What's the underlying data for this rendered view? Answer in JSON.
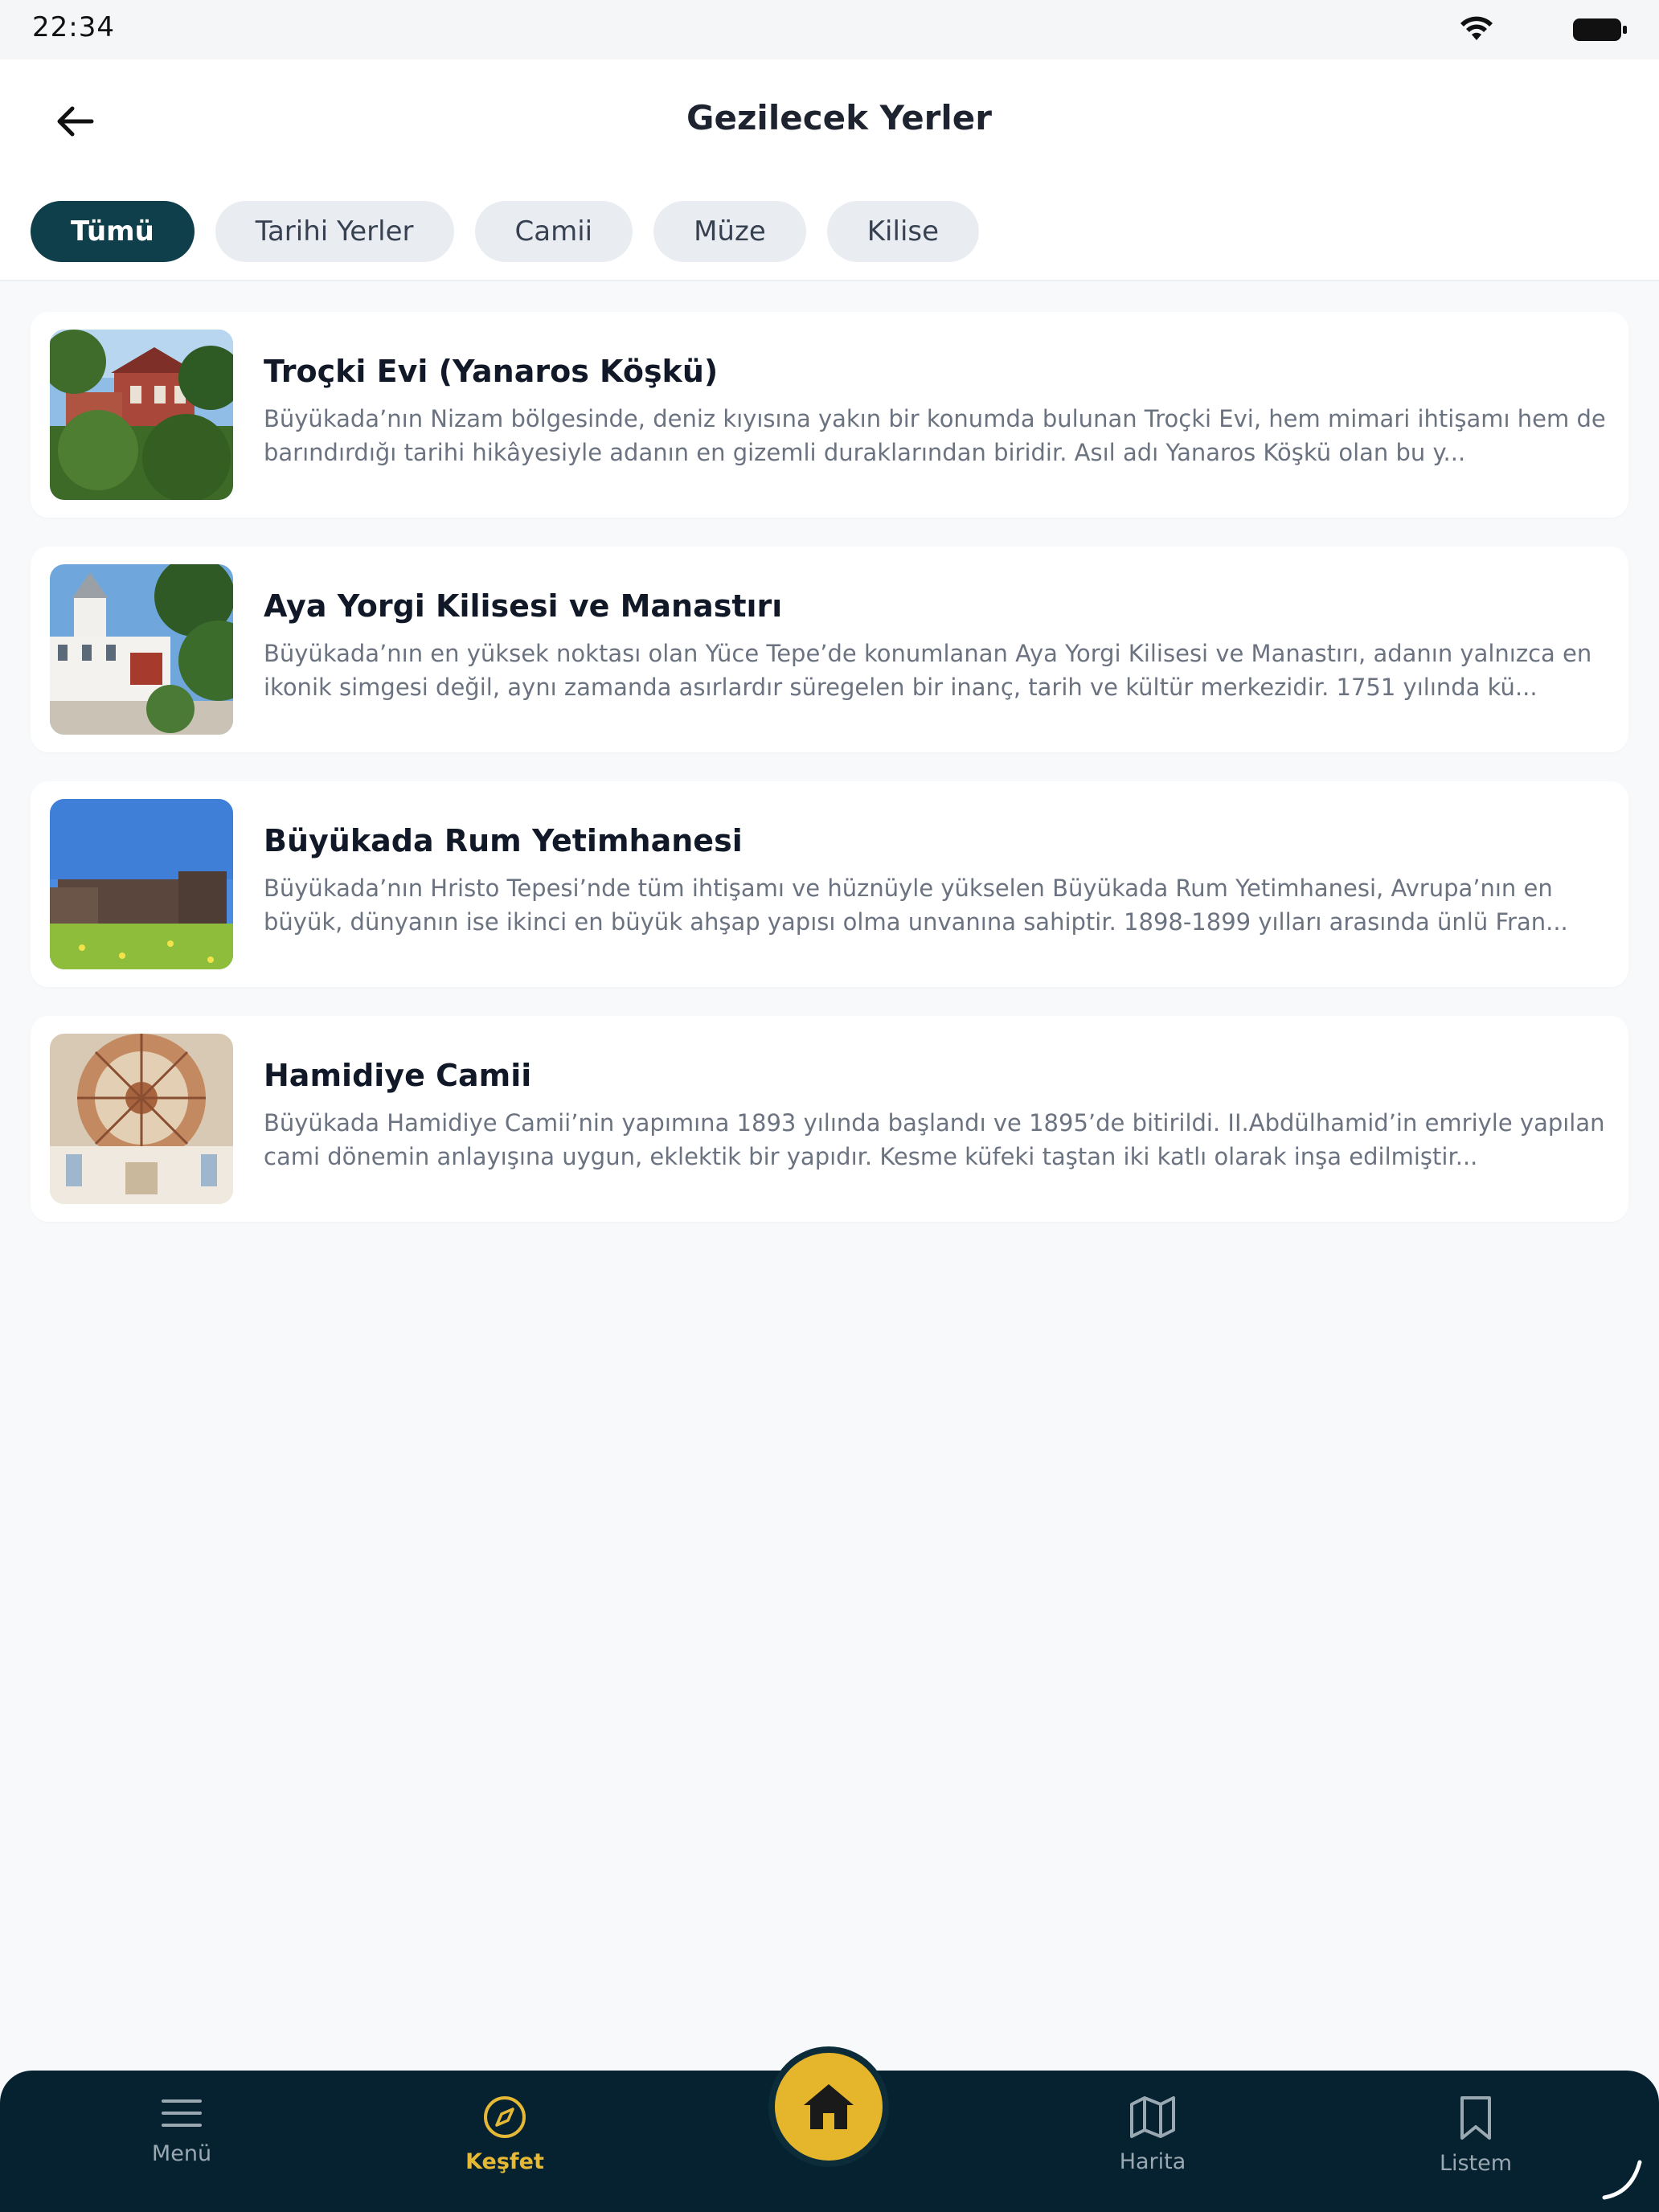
{
  "status_bar": {
    "time": "22:34"
  },
  "header": {
    "title": "Gezilecek Yerler",
    "filters": [
      {
        "label": "Tümü",
        "active": true
      },
      {
        "label": "Tarihi Yerler",
        "active": false
      },
      {
        "label": "Camii",
        "active": false
      },
      {
        "label": "Müze",
        "active": false
      },
      {
        "label": "Kilise",
        "active": false
      }
    ]
  },
  "places": [
    {
      "title": "Troçki Evi (Yanaros Köşkü)",
      "description": "Büyükada’nın Nizam bölgesinde, deniz kıyısına yakın bir konumda bulunan Troçki Evi, hem mimari ihtişamı hem de barındırdığı tarihi hikâyesiyle adanın en gizemli duraklarından biridir. Asıl adı Yanaros Köşkü olan bu y...",
      "image": "red-mansion-photo"
    },
    {
      "title": "Aya Yorgi Kilisesi ve Manastırı",
      "description": "Büyükada’nın en yüksek noktası olan Yüce Tepe’de konumlanan Aya Yorgi Kilisesi ve Manastırı, adanın yalnızca en ikonik simgesi değil, aynı zamanda asırlardır süregelen bir inanç, tarih ve kültür merkezidir. 1751 yılında kü...",
      "image": "monastery-photo"
    },
    {
      "title": "Büyükada Rum Yetimhanesi",
      "description": "Büyükada’nın Hristo Tepesi’nde tüm ihtişamı ve hüznüyle yükselen Büyükada Rum Yetimhanesi, Avrupa’nın en büyük, dünyanın ise ikinci en büyük ahşap yapısı olma unvanına sahiptir. 1898-1899 yılları arasında ünlü Fran...",
      "image": "orphanage-photo"
    },
    {
      "title": "Hamidiye Camii",
      "description": "Büyükada Hamidiye Camii’nin yapımına 1893 yılında başlandı ve 1895’de bitirildi. II.Abdülhamid’in emriyle yapılan cami dönemin anlayışına uygun, eklektik bir yapıdır. Kesme küfeki taştan iki katlı olarak inşa edilmiştir...",
      "image": "mosque-dome-photo"
    }
  ],
  "bottom_nav": {
    "menu": "Menü",
    "explore": "Keşfet",
    "map": "Harita",
    "list": "Listem"
  },
  "colors": {
    "accent": "#0e3f4a",
    "nav_bg": "#062230",
    "highlight": "#e5b836"
  }
}
